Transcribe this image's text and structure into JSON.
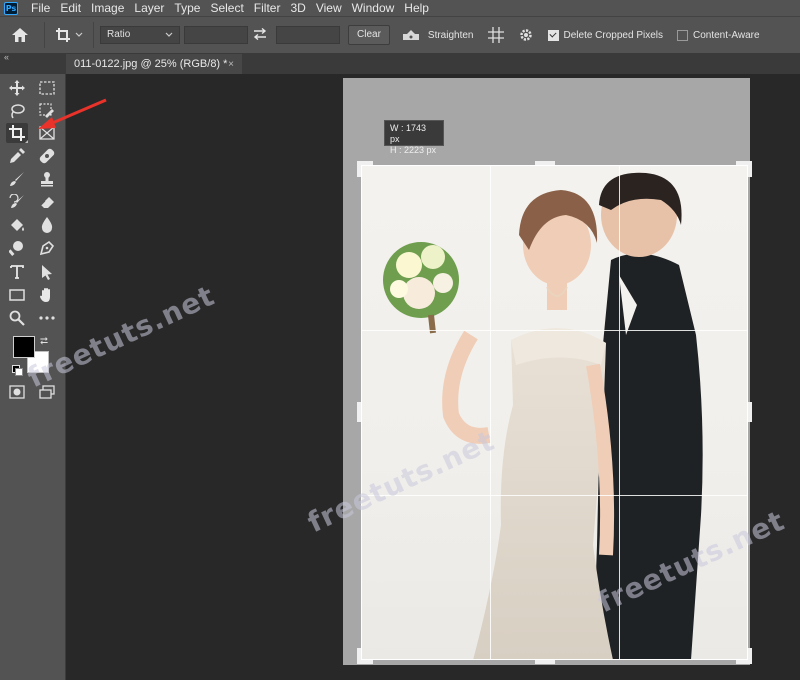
{
  "app": {
    "logo_text": "Ps"
  },
  "menu": [
    "File",
    "Edit",
    "Image",
    "Layer",
    "Type",
    "Select",
    "Filter",
    "3D",
    "View",
    "Window",
    "Help"
  ],
  "options": {
    "ratio_label": "Ratio",
    "clear_label": "Clear",
    "straighten_label": "Straighten",
    "delete_cropped_label": "Delete Cropped Pixels",
    "delete_cropped_checked": true,
    "content_aware_label": "Content-Aware",
    "content_aware_checked": false
  },
  "tab": {
    "title": "011-0122.jpg @ 25% (RGB/8) *",
    "close": "×"
  },
  "crop": {
    "width_label": "W :",
    "width_value": "1743 px",
    "height_label": "H :",
    "height_value": "2223 px"
  },
  "watermark": "freetuts.net",
  "colors": {
    "foreground": "#000000",
    "background": "#ffffff",
    "arrow": "#e8322a"
  }
}
